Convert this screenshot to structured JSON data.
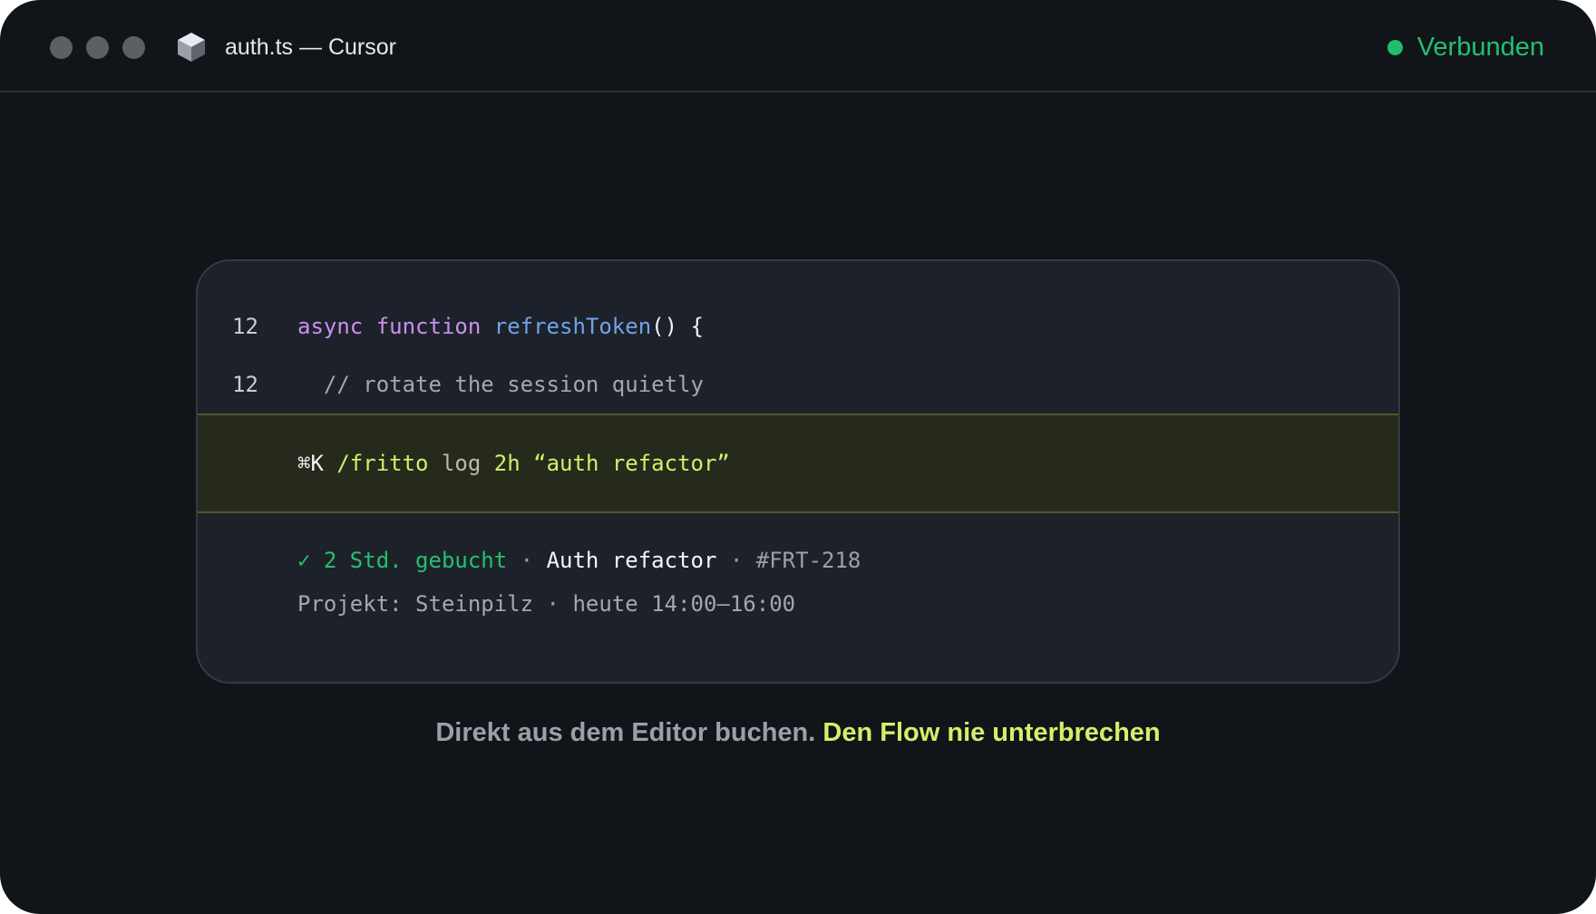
{
  "window": {
    "title": "auth.ts — Cursor",
    "app_icon": "cursor-cube-icon",
    "traffic_lights": [
      "close",
      "minimize",
      "zoom"
    ],
    "status": {
      "label": "Verbunden",
      "icon": "status-dot-icon",
      "color": "#22c06e"
    }
  },
  "editor": {
    "lines": [
      {
        "number": "12",
        "keyword1": "async",
        "keyword2": "function",
        "function_name": "refreshToken",
        "punct": "() {"
      },
      {
        "number": "12",
        "comment": "// rotate the session quietly"
      }
    ],
    "command": {
      "shortcut": "⌘K",
      "slash": "/fritto",
      "verb": "log",
      "duration": "2h",
      "description": "“auth refactor”",
      "highlight_color": "#262a1d"
    },
    "result": {
      "check": "✓",
      "booked": "2 Std. gebucht",
      "separator": "·",
      "task": "Auth refactor",
      "ticket": "#FRT-218",
      "project": "Projekt: Steinpilz",
      "time": "heute 14:00–16:00"
    }
  },
  "caption": {
    "part1": "Direkt aus dem Editor buchen.",
    "part2": "Den Flow nie unterbrechen"
  },
  "colors": {
    "background": "#111418",
    "card": "#1d222a",
    "accent": "#d2f06a",
    "success": "#23c06e"
  }
}
